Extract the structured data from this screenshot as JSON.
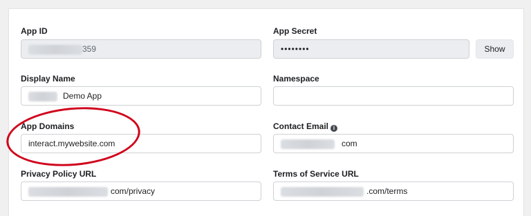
{
  "fields": {
    "app_id": {
      "label": "App ID",
      "value_suffix": "359"
    },
    "app_secret": {
      "label": "App Secret",
      "value": "••••••••",
      "show_button": "Show"
    },
    "display_name": {
      "label": "Display Name",
      "value_suffix": "Demo App"
    },
    "namespace": {
      "label": "Namespace",
      "value": ""
    },
    "app_domains": {
      "label": "App Domains",
      "value": "interact.mywebsite.com"
    },
    "contact_email": {
      "label": "Contact Email",
      "value_suffix": "com",
      "icon": "info-icon"
    },
    "privacy_policy_url": {
      "label": "Privacy Policy URL",
      "value_suffix": "com/privacy"
    },
    "terms_of_service_url": {
      "label": "Terms of Service URL",
      "value_suffix": ".com/terms"
    }
  },
  "annotation": {
    "shape": "ellipse",
    "color": "#d0021b"
  },
  "colors": {
    "panel_bg": "#ffffff",
    "page_bg": "#f0f0f0",
    "field_border": "#ced0d4",
    "readonly_bg": "#ebedf0"
  }
}
